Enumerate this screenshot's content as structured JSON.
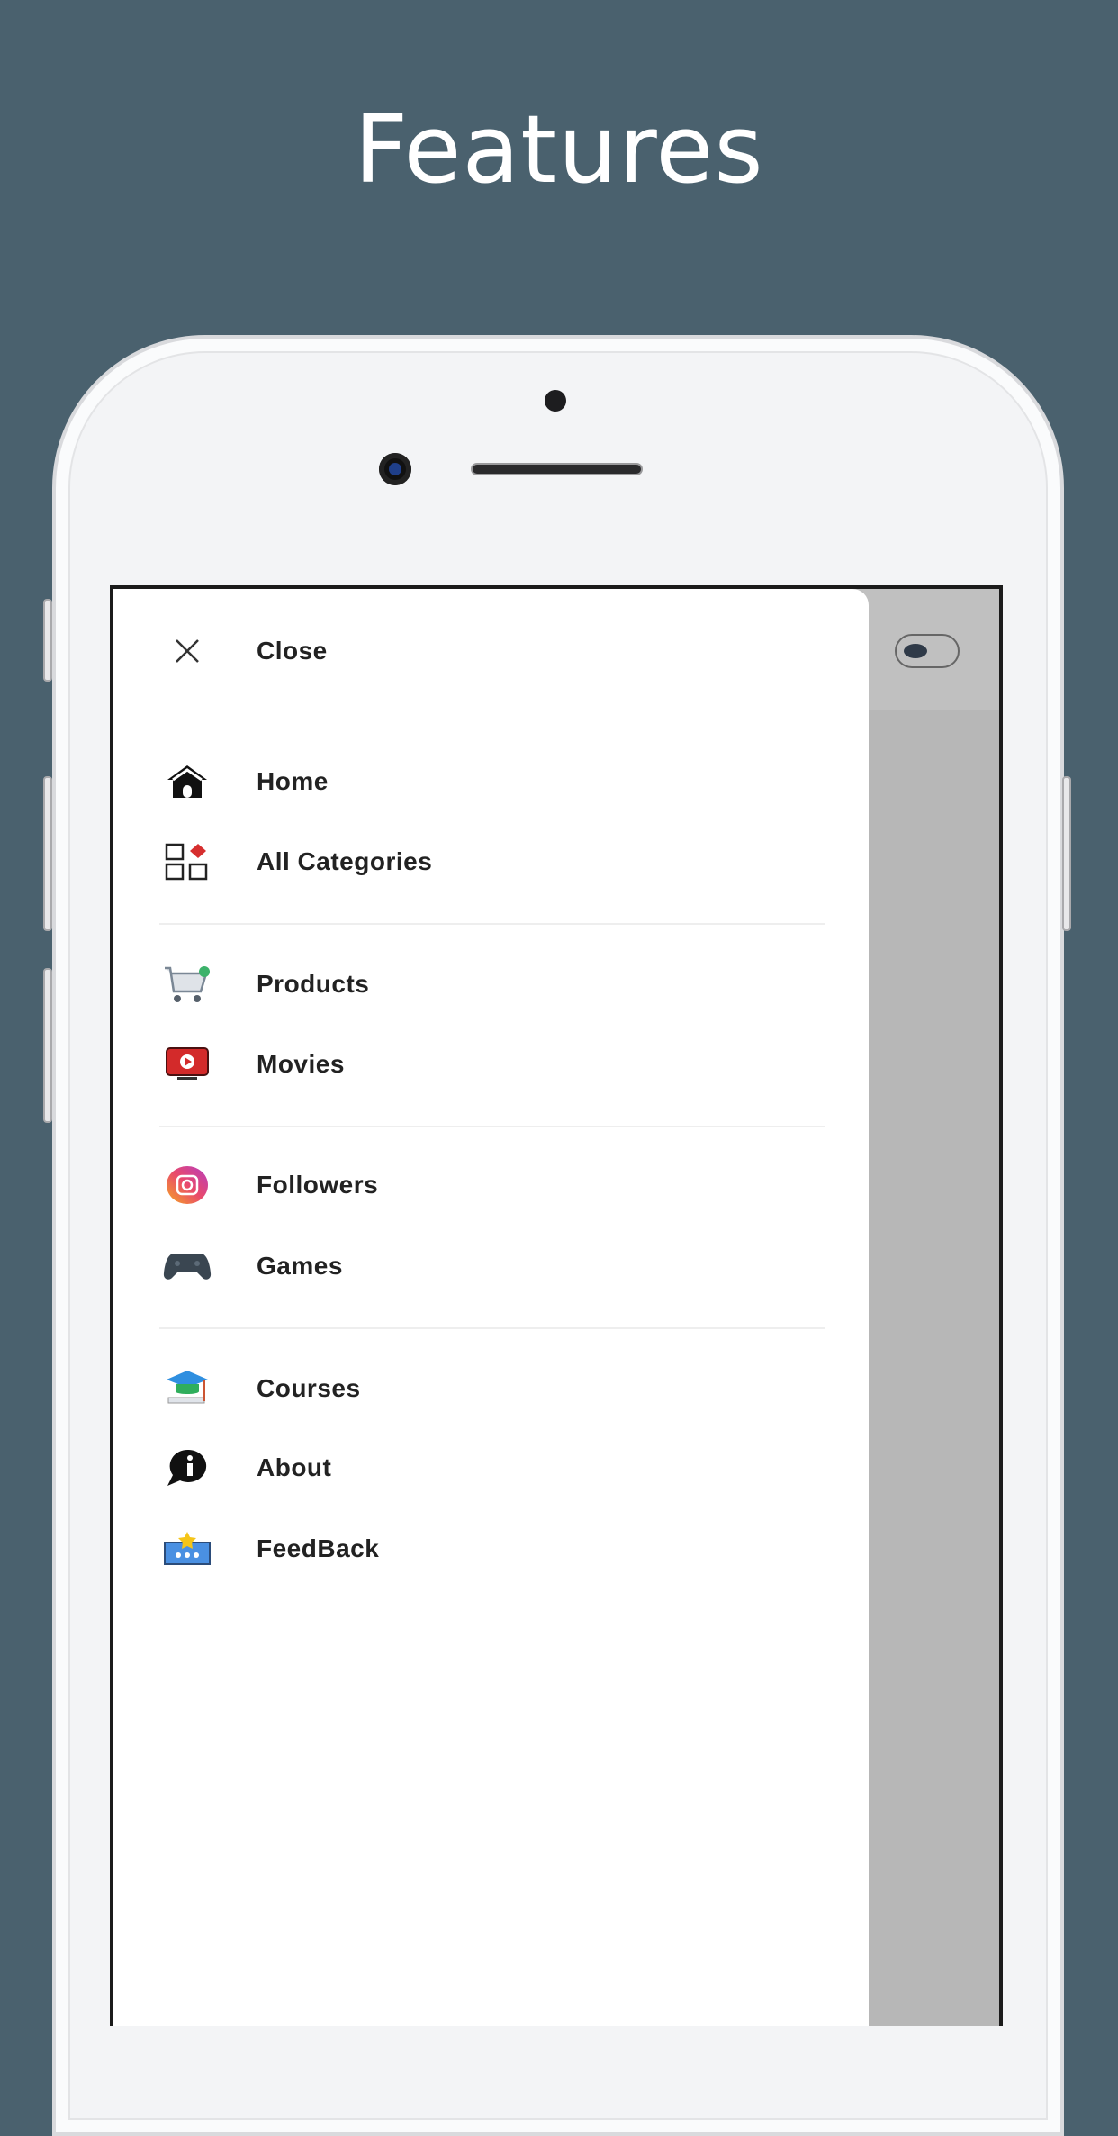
{
  "title": "Features",
  "drawer": {
    "close_label": "Close",
    "items": [
      {
        "label": "Home",
        "icon": "home-icon"
      },
      {
        "label": "All Categories",
        "icon": "categories-icon"
      },
      {
        "label": "Products",
        "icon": "cart-icon"
      },
      {
        "label": "Movies",
        "icon": "movie-tv-icon"
      },
      {
        "label": "Followers",
        "icon": "instagram-icon"
      },
      {
        "label": "Games",
        "icon": "gamepad-icon"
      },
      {
        "label": "Courses",
        "icon": "graduation-cap-icon"
      },
      {
        "label": "About",
        "icon": "info-bubble-icon"
      },
      {
        "label": "FeedBack",
        "icon": "feedback-icon"
      }
    ]
  },
  "colors": {
    "background": "#4a616e",
    "overlay": "#b7b7b7"
  }
}
